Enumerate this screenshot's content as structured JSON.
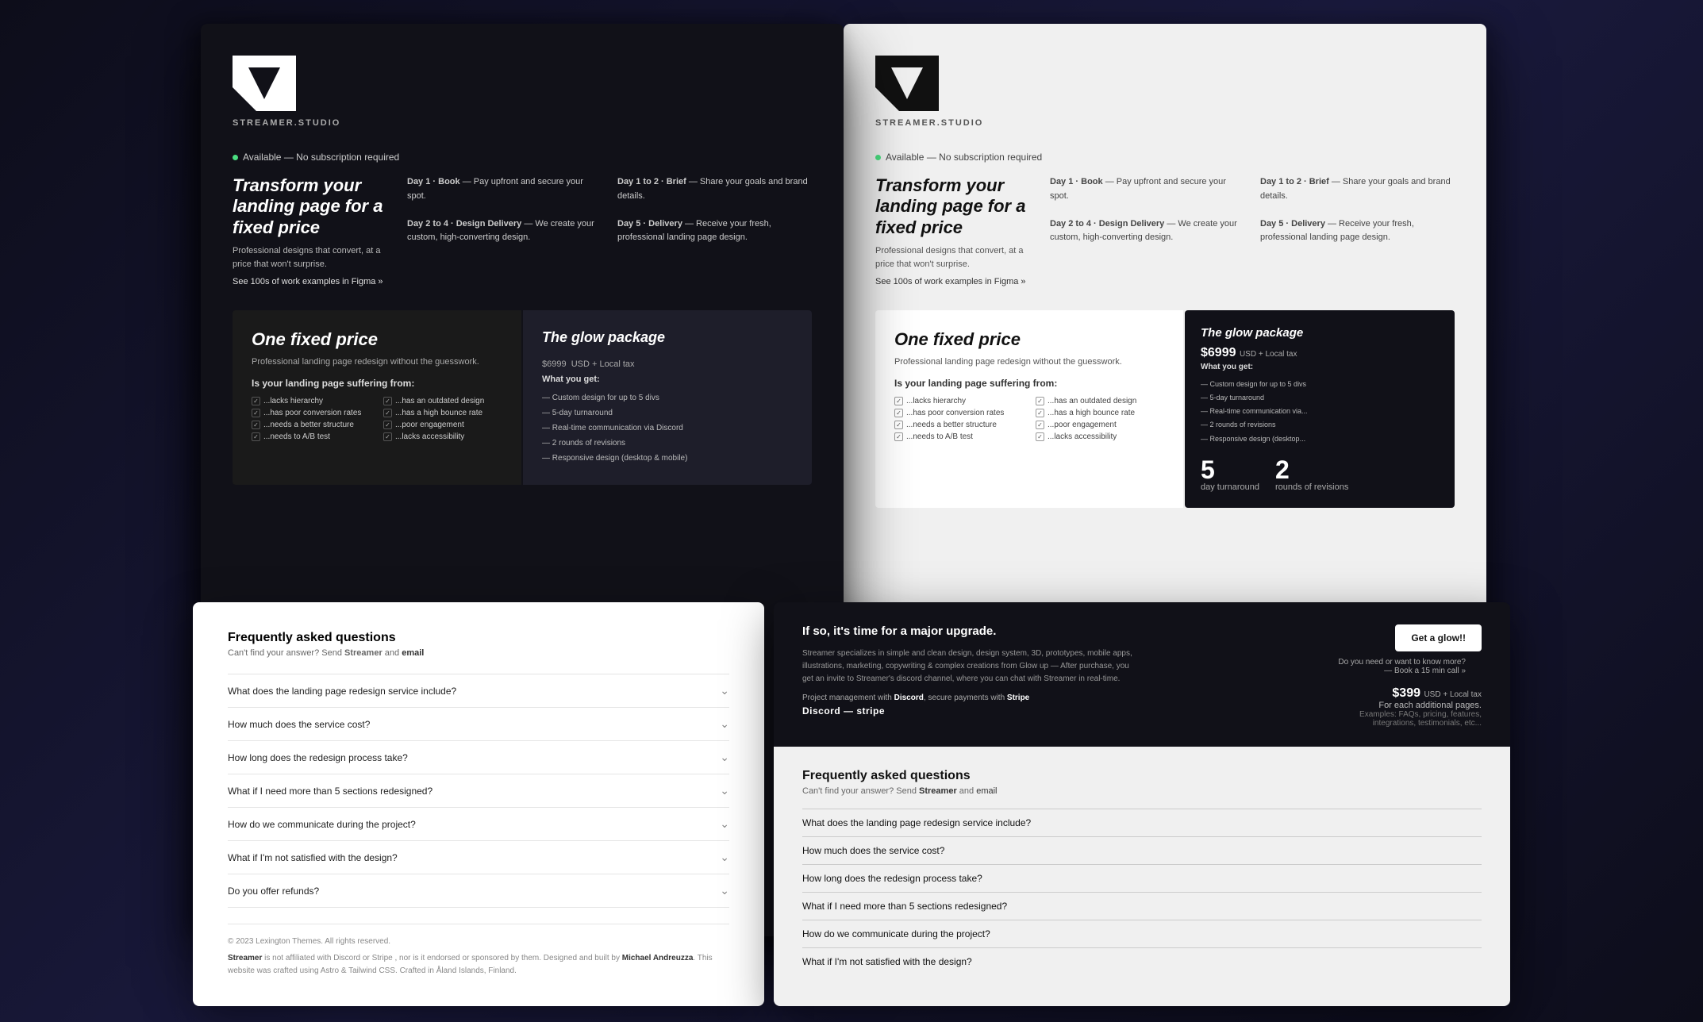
{
  "brand": {
    "name": "STREAMER.STUDIO",
    "tagline": "STREAMER.STUDIO"
  },
  "dark_screen": {
    "badge": "Available — No subscription required",
    "hero": {
      "headline": "Transform your landing page for a fixed price",
      "subtext": "Professional designs that convert, at a price that won't surprise.",
      "link": "See 100s of work examples in Figma  »"
    },
    "steps": {
      "col1": {
        "step1_title": "Day 1 · Book",
        "step1_text": "— Pay upfront and secure your spot.",
        "step2_title": "Day 2 to 4 · Design Delivery",
        "step2_text": "— We create your custom, high-converting design."
      },
      "col2": {
        "step1_title": "Day 1 to 2 · Brief",
        "step1_text": "— Share your goals and brand details.",
        "step2_title": "Day 5 · Delivery",
        "step2_text": "— Receive your fresh, professional landing page design."
      }
    },
    "pricing": {
      "left": {
        "headline": "One fixed price",
        "subtext": "Professional landing page redesign without the guesswork.",
        "suffering_title": "Is your landing page suffering from:",
        "checklist": [
          "...lacks hierarchy",
          "...has poor conversion rates",
          "...needs a better structure",
          "...needs to A/B test",
          "...has an outdated design",
          "...has a high bounce rate",
          "...poor engagement",
          "...lacks accessibility"
        ]
      },
      "right": {
        "package_title": "The glow package",
        "price": "$6999",
        "price_suffix": "USD + Local tax",
        "what_label": "What you get:",
        "items": [
          "Custom design for up to 5 divs",
          "5-day turnaround",
          "Real-time communication via Discord",
          "2 rounds of revisions",
          "Responsive design (desktop & mobile)"
        ]
      }
    }
  },
  "light_screen": {
    "badge": "Available — No subscription required",
    "hero": {
      "headline": "Transform your landing page for a fixed price",
      "subtext": "Professional designs that convert, at a price that won't surprise.",
      "link": "See 100s of work examples in Figma  »"
    },
    "steps": {
      "col1": {
        "step1_title": "Day 1 · Book",
        "step1_text": "— Pay upfront and secure your spot.",
        "step2_title": "Day 2 to 4 · Design Delivery",
        "step2_text": "— We create your custom, high-converting design."
      },
      "col2": {
        "step1_title": "Day 1 to 2 · Brief",
        "step1_text": "— Share your goals and brand details.",
        "step2_title": "Day 5 · Delivery",
        "step2_text": "— Receive your fresh, professional landing page design."
      }
    },
    "pricing": {
      "left": {
        "headline": "One fixed price",
        "subtext": "Professional landing page redesign without the guesswork.",
        "suffering_title": "Is your landing page suffering from:",
        "checklist": [
          "...lacks hierarchy",
          "...has poor conversion rates",
          "...needs a better structure",
          "...needs to A/B test",
          "...has an outdated design",
          "...has a high bounce rate",
          "...poor engagement",
          "...lacks accessibility"
        ]
      },
      "right": {
        "package_title": "The glow package",
        "price": "$6999",
        "price_suffix": "USD + Local tax",
        "what_label": "What you get:",
        "items": [
          "Custom design for up to 5 divs",
          "5-day turnaround",
          "Real-time communication via Discord",
          "2 rounds of revisions",
          "Responsive design (desktop & mobile)"
        ]
      }
    }
  },
  "right_dark_section": {
    "if_so_title": "If so, it's time for a major upgrade.",
    "if_so_desc": "Streamer specializes in simple and clean design, design system, 3D, prototypes, mobile apps, illustrations, marketing, copywriting & complex creations from Glow up — After purchase, you get an invite to Streamer's discord channel, where you can chat with Streamer in real-time.",
    "payment_text": "Project management with Discord, secure payments with Stripe",
    "discord_stripe": "Discord — stripe",
    "cta_button": "Get a glow!!",
    "book_call": "Do you need or want to know more?\n— Book a 15 min call »",
    "add_price": "$399",
    "add_price_suffix": "USD + Local tax",
    "add_price_label": "For each additional pages.",
    "add_price_examples": "Examples: FAQs, pricing, features, integrations, testimonials, etc...",
    "stats": {
      "days": "5",
      "days_label": "day turnaround",
      "revisions": "2",
      "revisions_label": "rounds of revisions"
    }
  },
  "faq_left": {
    "title": "Frequently asked questions",
    "subtext": "Can't find your answer? Send Streamer and email",
    "questions": [
      "What does the landing page redesign service include?",
      "How much does the service cost?",
      "How long does the redesign process take?",
      "What if I need more than 5 sections redesigned?",
      "How do we communicate during the project?",
      "What if I'm not satisfied with the design?",
      "Do you offer refunds?"
    ],
    "footer_copy": "© 2023 Lexington Themes. All rights reserved.",
    "footer_legal": "Streamer is not affiliated with Discord or Stripe , nor is it endorsed or sponsored by them. Designed and built by Michael Andreuzza. This website was crafted using Astro & Tailwind CSS. Crafted in Åland Islands, Finland."
  },
  "faq_right": {
    "title": "Frequently asked questions",
    "subtext": "Can't find your answer? Send Streamer and email",
    "questions": [
      "What does the landing page redesign service include?",
      "How much does the service cost?",
      "How long does the redesign process take?",
      "What if I need more than 5 sections redesigned?",
      "How do we communicate during the project?",
      "What if I'm not satisfied with the design?"
    ]
  }
}
